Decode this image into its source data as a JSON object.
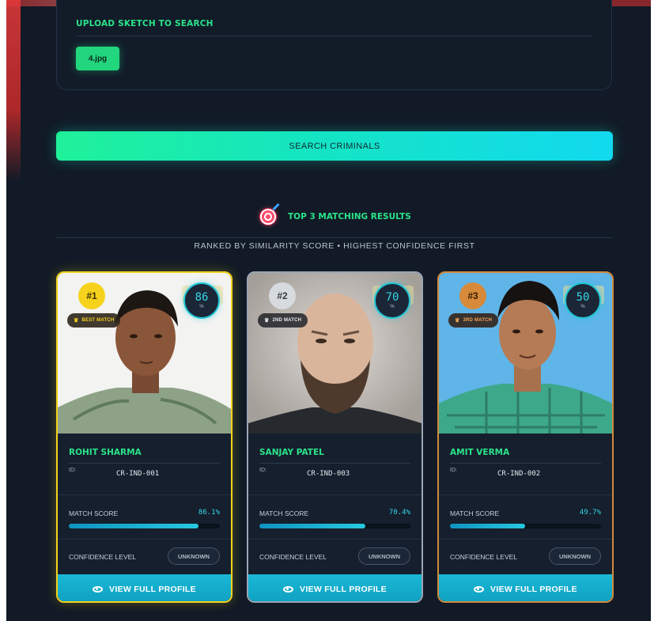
{
  "upload": {
    "title": "UPLOAD SKETCH TO SEARCH",
    "file_name": "4.jpg"
  },
  "search_button": {
    "label": "SEARCH CRIMINALS"
  },
  "results": {
    "icon": "target-dart-icon",
    "title": "TOP 3 MATCHING RESULTS",
    "subtitle": "RANKED BY SIMILARITY SCORE • HIGHEST CONFIDENCE FIRST",
    "cards": [
      {
        "rank": "#1",
        "tag": "BEST MATCH",
        "score": "86",
        "score_unit": "%",
        "name": "ROHIT SHARMA",
        "id_label": "ID:",
        "id_value": "CR-IND-001",
        "match_score_label": "MATCH SCORE",
        "match_score_value": "86.1%",
        "match_fraction": 0.861,
        "confidence_label": "CONFIDENCE LEVEL",
        "confidence_value": "UNKNOWN",
        "button_label": "VIEW FULL PROFILE",
        "accent": "#f3d21a"
      },
      {
        "rank": "#2",
        "tag": "2ND MATCH",
        "score": "70",
        "score_unit": "%",
        "name": "SANJAY PATEL",
        "id_label": "ID:",
        "id_value": "CR-IND-003",
        "match_score_label": "MATCH SCORE",
        "match_score_value": "70.4%",
        "match_fraction": 0.704,
        "confidence_label": "CONFIDENCE LEVEL",
        "confidence_value": "UNKNOWN",
        "button_label": "VIEW FULL PROFILE",
        "accent": "#9aa6b6"
      },
      {
        "rank": "#3",
        "tag": "3RD MATCH",
        "score": "50",
        "score_unit": "%",
        "name": "AMIT VERMA",
        "id_label": "ID:",
        "id_value": "CR-IND-002",
        "match_score_label": "MATCH SCORE",
        "match_score_value": "49.7%",
        "match_fraction": 0.497,
        "confidence_label": "CONFIDENCE LEVEL",
        "confidence_value": "UNKNOWN",
        "button_label": "VIEW FULL PROFILE",
        "accent": "#d28a3c"
      }
    ]
  },
  "colors": {
    "background": "#111a26",
    "accent_green": "#2be38a",
    "accent_cyan": "#35d6e6"
  }
}
